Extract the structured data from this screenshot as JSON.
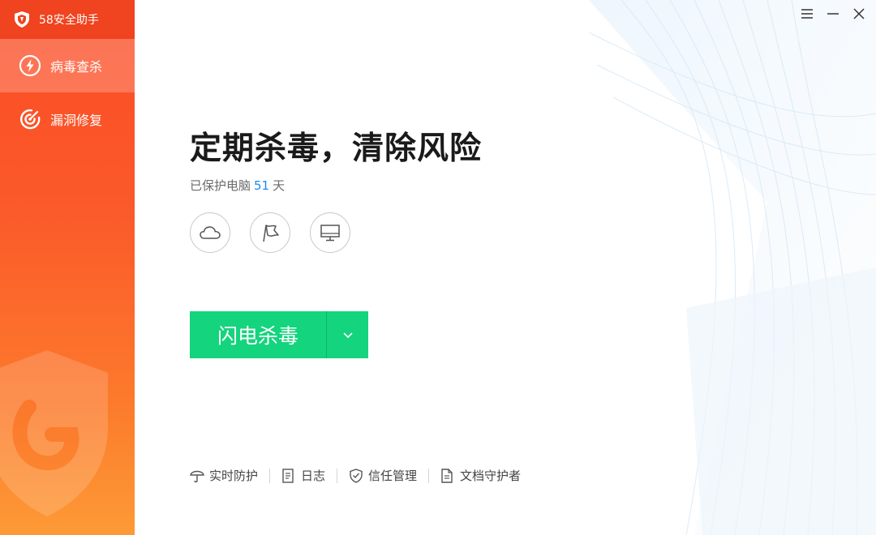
{
  "app": {
    "title": "58安全助手"
  },
  "sidebar": {
    "items": [
      {
        "label": "病毒查杀",
        "icon": "lightning-icon",
        "active": true
      },
      {
        "label": "漏洞修复",
        "icon": "target-icon",
        "active": false
      }
    ]
  },
  "window": {
    "menu_icon": "menu-icon",
    "minimize_icon": "minimize-icon",
    "close_icon": "close-icon"
  },
  "main": {
    "headline": "定期杀毒，清除风险",
    "protected_prefix": "已保护电脑",
    "protected_days": "51",
    "protected_suffix": "天",
    "quick_icons": [
      "cloud-icon",
      "flag-icon",
      "monitor-icon"
    ],
    "scan_button": "闪电杀毒",
    "bottom_links": [
      {
        "label": "实时防护",
        "icon": "umbrella-icon"
      },
      {
        "label": "日志",
        "icon": "document-icon"
      },
      {
        "label": "信任管理",
        "icon": "shield-check-icon"
      },
      {
        "label": "文档守护者",
        "icon": "file-icon"
      }
    ]
  },
  "colors": {
    "sidebar_top": "#fb4b26",
    "sidebar_bottom": "#fd9a36",
    "scan_green": "#14d47d",
    "days_blue": "#1a8cf0"
  }
}
